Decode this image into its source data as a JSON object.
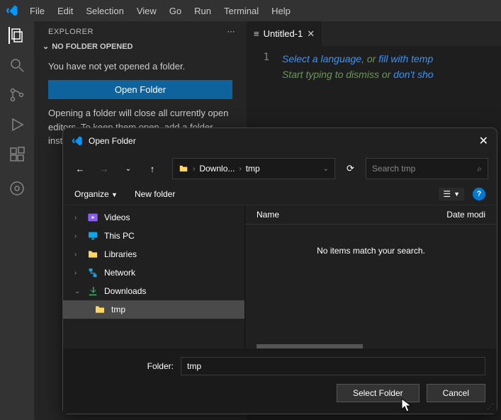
{
  "menubar": [
    "File",
    "Edit",
    "Selection",
    "View",
    "Go",
    "Run",
    "Terminal",
    "Help"
  ],
  "explorer": {
    "title": "EXPLORER",
    "section": "NO FOLDER OPENED",
    "no_folder_msg": "You have not yet opened a folder.",
    "open_folder_btn": "Open Folder",
    "hint": "Opening a folder will close all currently open editors. To keep them open, add a folder instead."
  },
  "editor": {
    "tab_label": "Untitled-1",
    "line_number": "1",
    "hint_select": "Select a language",
    "hint_or": ", or ",
    "hint_fill": "fill with temp",
    "hint_line2a": "Start typing to dismiss or ",
    "hint_line2b": "don't sho"
  },
  "dialog": {
    "title": "Open Folder",
    "breadcrumb": [
      "Downlo...",
      "tmp"
    ],
    "search_placeholder": "Search tmp",
    "organize": "Organize",
    "new_folder": "New folder",
    "tree": [
      {
        "label": "Videos",
        "icon": "videos",
        "caret": true,
        "selected": false,
        "indent": false
      },
      {
        "label": "This PC",
        "icon": "pc",
        "caret": true,
        "selected": false,
        "indent": false
      },
      {
        "label": "Libraries",
        "icon": "folder",
        "caret": true,
        "selected": false,
        "indent": false
      },
      {
        "label": "Network",
        "icon": "network",
        "caret": true,
        "selected": false,
        "indent": false
      },
      {
        "label": "Downloads",
        "icon": "download",
        "caret": true,
        "expanded": true,
        "selected": false,
        "indent": false
      },
      {
        "label": "tmp",
        "icon": "folder",
        "caret": false,
        "selected": true,
        "indent": true
      }
    ],
    "columns": {
      "name": "Name",
      "date": "Date modi"
    },
    "empty_msg": "No items match your search.",
    "folder_label": "Folder:",
    "folder_value": "tmp",
    "select_btn": "Select Folder",
    "cancel_btn": "Cancel"
  }
}
